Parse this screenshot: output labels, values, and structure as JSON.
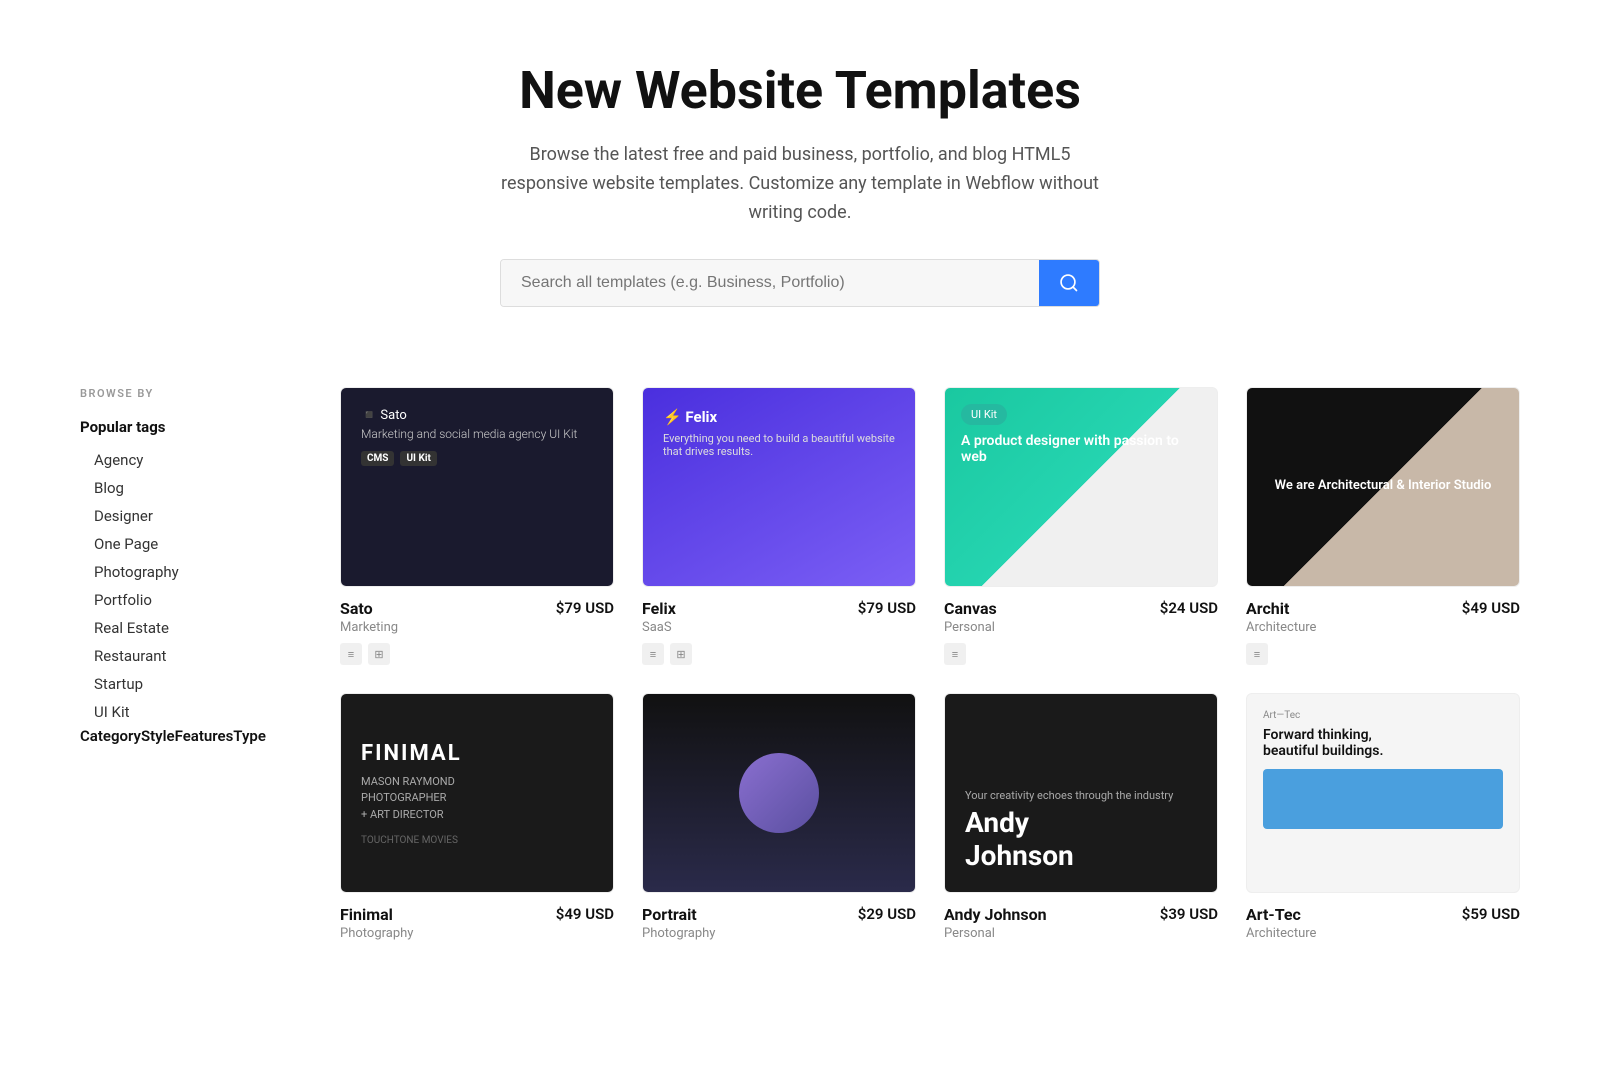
{
  "hero": {
    "title": "New Website Templates",
    "subtitle": "Browse the latest free and paid business, portfolio, and blog HTML5 responsive website templates. Customize any template in Webflow without writing code.",
    "search_placeholder": "Search all templates (e.g. Business, Portfolio)"
  },
  "sidebar": {
    "browse_by_label": "BROWSE BY",
    "popular_tags_label": "Popular tags",
    "tags": [
      {
        "label": "Agency"
      },
      {
        "label": "Blog"
      },
      {
        "label": "Designer"
      },
      {
        "label": "One Page"
      },
      {
        "label": "Photography"
      },
      {
        "label": "Portfolio"
      },
      {
        "label": "Real Estate"
      },
      {
        "label": "Restaurant"
      },
      {
        "label": "Startup"
      },
      {
        "label": "UI Kit"
      }
    ],
    "categories": [
      {
        "label": "Category"
      },
      {
        "label": "Style"
      },
      {
        "label": "Features"
      },
      {
        "label": "Type"
      }
    ]
  },
  "templates": [
    {
      "name": "Sato",
      "category": "Marketing",
      "price": "$79 USD",
      "thumb_type": "sato",
      "badges": [
        "cms",
        "ui"
      ]
    },
    {
      "name": "Felix",
      "category": "SaaS",
      "price": "$79 USD",
      "thumb_type": "felix",
      "badges": [
        "cms",
        "ui"
      ]
    },
    {
      "name": "Canvas",
      "category": "Personal",
      "price": "$24 USD",
      "thumb_type": "canvas",
      "badges": [
        "cms"
      ]
    },
    {
      "name": "Archit",
      "category": "Architecture",
      "price": "$49 USD",
      "thumb_type": "archit",
      "badges": [
        "cms"
      ]
    },
    {
      "name": "Finimal",
      "category": "Photography",
      "price": "$49 USD",
      "thumb_type": "finimal",
      "badges": []
    },
    {
      "name": "Portrait",
      "category": "Photography",
      "price": "$29 USD",
      "thumb_type": "portrait",
      "badges": []
    },
    {
      "name": "Andy Johnson",
      "category": "Personal",
      "price": "$39 USD",
      "thumb_type": "andy",
      "badges": []
    },
    {
      "name": "Art-Tec",
      "category": "Architecture",
      "price": "$59 USD",
      "thumb_type": "art",
      "badges": []
    }
  ]
}
